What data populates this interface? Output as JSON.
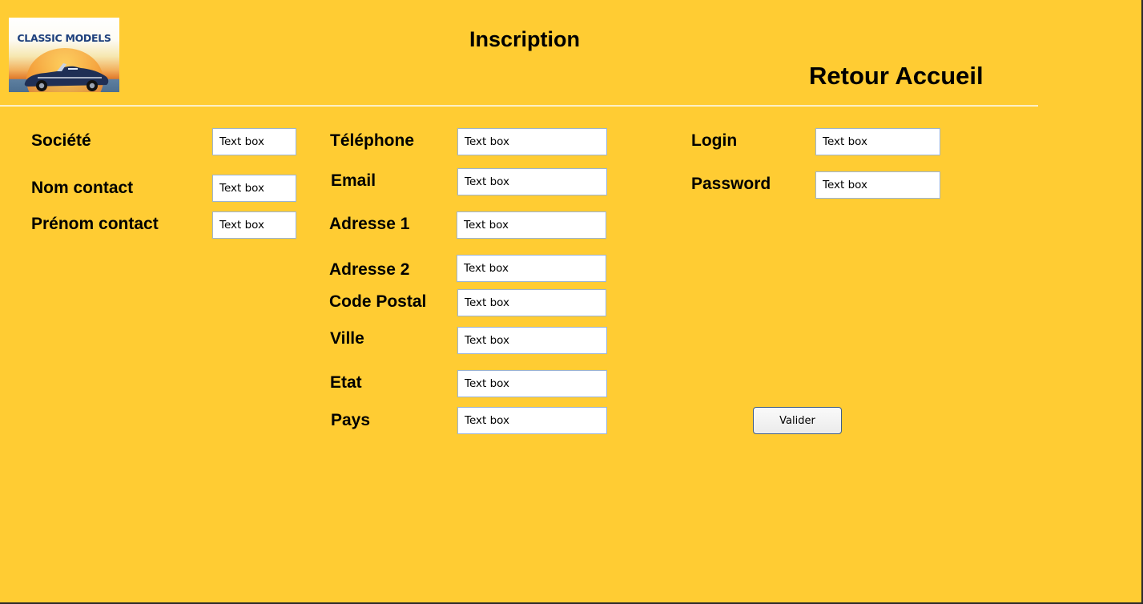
{
  "header": {
    "logo_text": "CLASSIC MODELS",
    "title": "Inscription",
    "back_link": "Retour Accueil"
  },
  "form": {
    "placeholder": "Text box",
    "company": {
      "label": "Société"
    },
    "contact_last_name": {
      "label": "Nom contact"
    },
    "contact_first_name": {
      "label": "Prénom contact"
    },
    "phone": {
      "label": "Téléphone"
    },
    "email": {
      "label": "Email"
    },
    "address1": {
      "label": "Adresse 1"
    },
    "address2": {
      "label": "Adresse 2"
    },
    "postal_code": {
      "label": "Code Postal"
    },
    "city": {
      "label": "Ville"
    },
    "state": {
      "label": "Etat"
    },
    "country": {
      "label": "Pays"
    },
    "login": {
      "label": "Login"
    },
    "password": {
      "label": "Password"
    },
    "submit_label": "Valider"
  },
  "colors": {
    "background": "#ffcc33",
    "field_border": "#9bb4d6",
    "button_border": "#3f5d86"
  }
}
